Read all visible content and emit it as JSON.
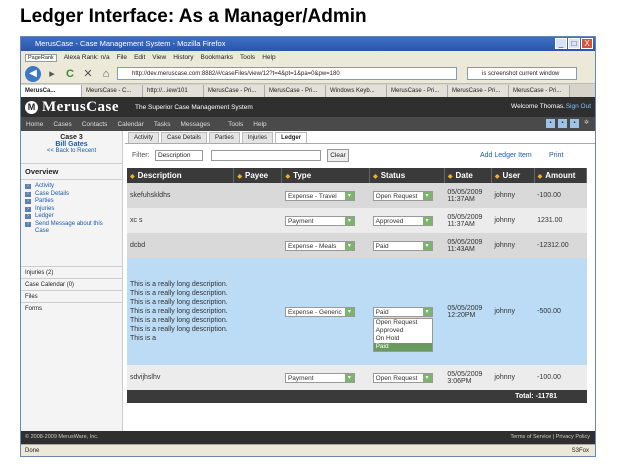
{
  "heading": "Ledger Interface: As a Manager/Admin",
  "window": {
    "title": "MerusCase - Case Management System - Mozilla Firefox",
    "buttons": [
      "_",
      "□",
      "X"
    ]
  },
  "menu": {
    "pagerank": "PageRank",
    "alexa": "Alexa Rank: n/a",
    "items": [
      "File",
      "Edit",
      "View",
      "History",
      "Bookmarks",
      "Tools",
      "Help"
    ]
  },
  "nav": {
    "url": "http://dev.meruscase.com:8882/#/caseFiles/view/12?t=4&pt=1&pa=0&pw=180",
    "search": "is screenshot current window",
    "back": "◀",
    "forward": "▸",
    "reload": "C",
    "stop": "✕",
    "home": "⌂"
  },
  "browser_tabs": [
    "MerusCa...",
    "MeursCase - C...",
    "http://...iew/101",
    "MerusCase - Pri...",
    "MerusCase - Pri...",
    "Windows Keyb...",
    "MerusCase - Pri...",
    "MerusCase - Pri...",
    "MerusCase - Pri..."
  ],
  "app": {
    "brand": "MerusCase",
    "tagline": "The Superior Case Management System",
    "welcome": "Welcome Thomas.",
    "signout": "Sign Out",
    "nav": [
      "Home",
      "Cases",
      "Contacts",
      "Calendar",
      "Tasks",
      "Messages",
      "Tools",
      "Help"
    ]
  },
  "sidebar": {
    "case_no": "Case 3",
    "client": "Bill Gates",
    "back": "<< Back to Recent",
    "overview": "Overview",
    "links": [
      "Activity",
      "Case Details",
      "Parties",
      "Injuries",
      "Ledger",
      "Send Message about this Case"
    ],
    "sections": [
      "Injuries (2)",
      "Case Calendar (0)",
      "Files",
      "Forms"
    ]
  },
  "content_tabs": [
    "Activity",
    "Case Details",
    "Parties",
    "Injuries",
    "Ledger"
  ],
  "filter": {
    "label": "Filter:",
    "field": "Description",
    "clear": "Clear",
    "add": "Add Ledger Item",
    "print": "Print"
  },
  "table": {
    "headers": [
      "Description",
      "Payee",
      "Type",
      "Status",
      "Date",
      "User",
      "Amount"
    ],
    "rows": [
      {
        "desc": "skefuhskldhs",
        "payee": "",
        "type": "Expense - Travel",
        "status": "Open Request",
        "date": "05/05/2009",
        "time": "11:37AM",
        "user": "johnny",
        "amount": "-100.00"
      },
      {
        "desc": "xc s",
        "payee": "",
        "type": "Payment",
        "status": "Approved",
        "date": "05/05/2009",
        "time": "11:37AM",
        "user": "johnny",
        "amount": "1231.00"
      },
      {
        "desc": "dcbd",
        "payee": "",
        "type": "Expense - Meals",
        "status": "Paid",
        "date": "05/05/2009",
        "time": "11:43AM",
        "user": "johnny",
        "amount": "-12312.00"
      },
      {
        "desc": "This is a really long description. This is a really long description. This is a really long description. This is a really long description. This is a really long description. This is a really long description. This is a",
        "payee": "",
        "type": "Expense - Generic",
        "status": "Paid",
        "date": "05/05/2009",
        "time": "12:20PM",
        "user": "johnny",
        "amount": "-500.00"
      },
      {
        "desc": "sdvijhslhv",
        "payee": "",
        "type": "Payment",
        "status": "Open Request",
        "date": "05/05/2009",
        "time": "3:06PM",
        "user": "johnny",
        "amount": "-100.00"
      }
    ],
    "status_options": [
      "Open Request",
      "Approved",
      "On Hold",
      "Paid"
    ],
    "total": "Total:  -11781"
  },
  "footer": {
    "copyright": "© 2008-2009 MerusWare, Inc.",
    "links": "Terms of Service | Privacy Policy"
  },
  "statusbar": {
    "text": "Done",
    "right": "S3Fox"
  }
}
